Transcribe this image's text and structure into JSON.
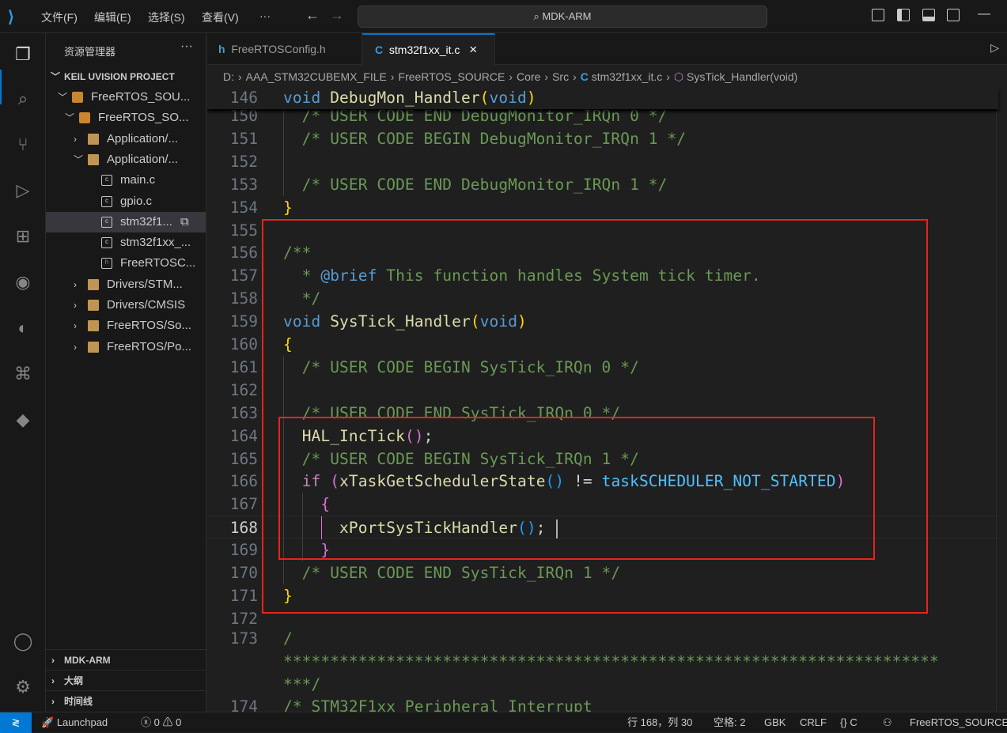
{
  "titlebar": {
    "menus": [
      "文件(F)",
      "编辑(E)",
      "选择(S)",
      "查看(V)",
      "···"
    ],
    "search": "MDK-ARM",
    "back": "←",
    "forward": "→"
  },
  "explorer": {
    "title": "资源管理器",
    "more": "···",
    "section": "KEIL UVISION PROJECT",
    "items": [
      {
        "label": "FreeRTOS_SOU...",
        "type": "proj",
        "depth": 1,
        "chev": "v"
      },
      {
        "label": "FreeRTOS_SO...",
        "type": "proj",
        "depth": 2,
        "chev": "v"
      },
      {
        "label": "Application/...",
        "type": "folder",
        "depth": 3,
        "chev": ">"
      },
      {
        "label": "Application/...",
        "type": "folder",
        "depth": 3,
        "chev": "v"
      },
      {
        "label": "main.c",
        "type": "c",
        "depth": 4,
        "chev": ""
      },
      {
        "label": "gpio.c",
        "type": "c",
        "depth": 4,
        "chev": ""
      },
      {
        "label": "stm32f1...",
        "type": "c",
        "depth": 4,
        "chev": "",
        "selected": true
      },
      {
        "label": "stm32f1xx_...",
        "type": "c",
        "depth": 4,
        "chev": ""
      },
      {
        "label": "FreeRTOSC...",
        "type": "h",
        "depth": 4,
        "chev": ""
      },
      {
        "label": "Drivers/STM...",
        "type": "folder",
        "depth": 3,
        "chev": ">"
      },
      {
        "label": "Drivers/CMSIS",
        "type": "folder",
        "depth": 3,
        "chev": ">"
      },
      {
        "label": "FreeRTOS/So...",
        "type": "folder",
        "depth": 3,
        "chev": ">"
      },
      {
        "label": "FreeRTOS/Po...",
        "type": "folder",
        "depth": 3,
        "chev": ">"
      }
    ],
    "panels": [
      "MDK-ARM",
      "大纲",
      "时间线"
    ]
  },
  "tabs": [
    {
      "label": "FreeRTOSConfig.h",
      "icon": "h"
    },
    {
      "label": "stm32f1xx_it.c",
      "icon": "C",
      "close": "×"
    }
  ],
  "breadcrumbs": [
    "D:",
    "AAA_STM32CUBEMX_FILE",
    "FreeRTOS_SOURCE",
    "Core",
    "Src",
    "stm32f1xx_it.c",
    "SysTick_Handler(void)"
  ],
  "editor": {
    "sticky": {
      "num": "146",
      "tokens": [
        [
          "void",
          "kw"
        ],
        [
          " ",
          "tx"
        ],
        [
          "DebugMon_Handler",
          "fn"
        ],
        [
          "(",
          "b1"
        ],
        [
          "void",
          "kw"
        ],
        [
          ")",
          "b1"
        ]
      ]
    },
    "current_line": "168",
    "lines": [
      {
        "num": "150",
        "tokens": [
          [
            "  /* USER CODE END DebugMonitor_IRQn 0 */",
            "cm"
          ]
        ]
      },
      {
        "num": "151",
        "tokens": [
          [
            "  /* USER CODE BEGIN DebugMonitor_IRQn 1 */",
            "cm"
          ]
        ]
      },
      {
        "num": "152",
        "tokens": []
      },
      {
        "num": "153",
        "tokens": [
          [
            "  /* USER CODE END DebugMonitor_IRQn 1 */",
            "cm"
          ]
        ]
      },
      {
        "num": "154",
        "tokens": [
          [
            "}",
            "b1"
          ]
        ]
      },
      {
        "num": "155",
        "tokens": []
      },
      {
        "num": "156",
        "tokens": [
          [
            "/**",
            "cm"
          ]
        ]
      },
      {
        "num": "157",
        "tokens": [
          [
            "  * ",
            "cm"
          ],
          [
            "@brief",
            "tag"
          ],
          [
            " This function handles System tick timer.",
            "cm"
          ]
        ]
      },
      {
        "num": "158",
        "tokens": [
          [
            "  */",
            "cm"
          ]
        ]
      },
      {
        "num": "159",
        "tokens": [
          [
            "void",
            "kw"
          ],
          [
            " ",
            "tx"
          ],
          [
            "SysTick_Handler",
            "fn"
          ],
          [
            "(",
            "b1"
          ],
          [
            "void",
            "kw"
          ],
          [
            ")",
            "b1"
          ]
        ]
      },
      {
        "num": "160",
        "tokens": [
          [
            "{",
            "b1"
          ]
        ]
      },
      {
        "num": "161",
        "tokens": [
          [
            "  /* USER CODE BEGIN SysTick_IRQn 0 */",
            "cm"
          ]
        ]
      },
      {
        "num": "162",
        "tokens": []
      },
      {
        "num": "163",
        "tokens": [
          [
            "  /* USER CODE END SysTick_IRQn 0 */",
            "cm"
          ]
        ]
      },
      {
        "num": "164",
        "tokens": [
          [
            "  ",
            "tx"
          ],
          [
            "HAL_IncTick",
            "fn"
          ],
          [
            "(",
            "b2"
          ],
          [
            ")",
            "b2"
          ],
          [
            ";",
            "tx"
          ]
        ]
      },
      {
        "num": "165",
        "tokens": [
          [
            "  /* USER CODE BEGIN SysTick_IRQn 1 */",
            "cm"
          ]
        ]
      },
      {
        "num": "166",
        "tokens": [
          [
            "  ",
            "tx"
          ],
          [
            "if",
            "ctl"
          ],
          [
            " ",
            "tx"
          ],
          [
            "(",
            "b2"
          ],
          [
            "xTaskGetSchedulerState",
            "fn"
          ],
          [
            "(",
            "b3"
          ],
          [
            ")",
            "b3"
          ],
          [
            " != ",
            "tx"
          ],
          [
            "taskSCHEDULER_NOT_STARTED",
            "cst"
          ],
          [
            ")",
            "b2"
          ]
        ]
      },
      {
        "num": "167",
        "tokens": [
          [
            "    ",
            "tx"
          ],
          [
            "{",
            "b2"
          ]
        ]
      },
      {
        "num": "168",
        "tokens": [
          [
            "      ",
            "tx"
          ],
          [
            "xPortSysTickHandler",
            "fn"
          ],
          [
            "(",
            "b3"
          ],
          [
            ")",
            "b3"
          ],
          [
            "; ",
            "tx"
          ]
        ],
        "caret": true
      },
      {
        "num": "169",
        "tokens": [
          [
            "    ",
            "tx"
          ],
          [
            "}",
            "b2"
          ]
        ]
      },
      {
        "num": "170",
        "tokens": [
          [
            "  /* USER CODE END SysTick_IRQn 1 */",
            "cm"
          ]
        ]
      },
      {
        "num": "171",
        "tokens": [
          [
            "}",
            "b1"
          ]
        ]
      },
      {
        "num": "172",
        "tokens": []
      },
      {
        "num": "173",
        "tokens": [
          [
            "/",
            "cm"
          ]
        ]
      },
      {
        "num": "",
        "tokens": [
          [
            "**********************************************************************",
            "cm"
          ]
        ]
      },
      {
        "num": "",
        "tokens": [
          [
            "***/",
            "cm"
          ]
        ]
      },
      {
        "num": "174",
        "tokens": [
          [
            "/* STM32F1xx Peripheral Interrupt",
            "cm"
          ]
        ]
      }
    ]
  },
  "statusbar": {
    "launchpad": "Launchpad",
    "errors": "0",
    "warnings": "0",
    "position": "行 168，列 30",
    "spaces": "空格: 2",
    "encoding": "GBK",
    "eol": "CRLF",
    "language": "C",
    "workspace": "FreeRTOS_SOURCE"
  }
}
